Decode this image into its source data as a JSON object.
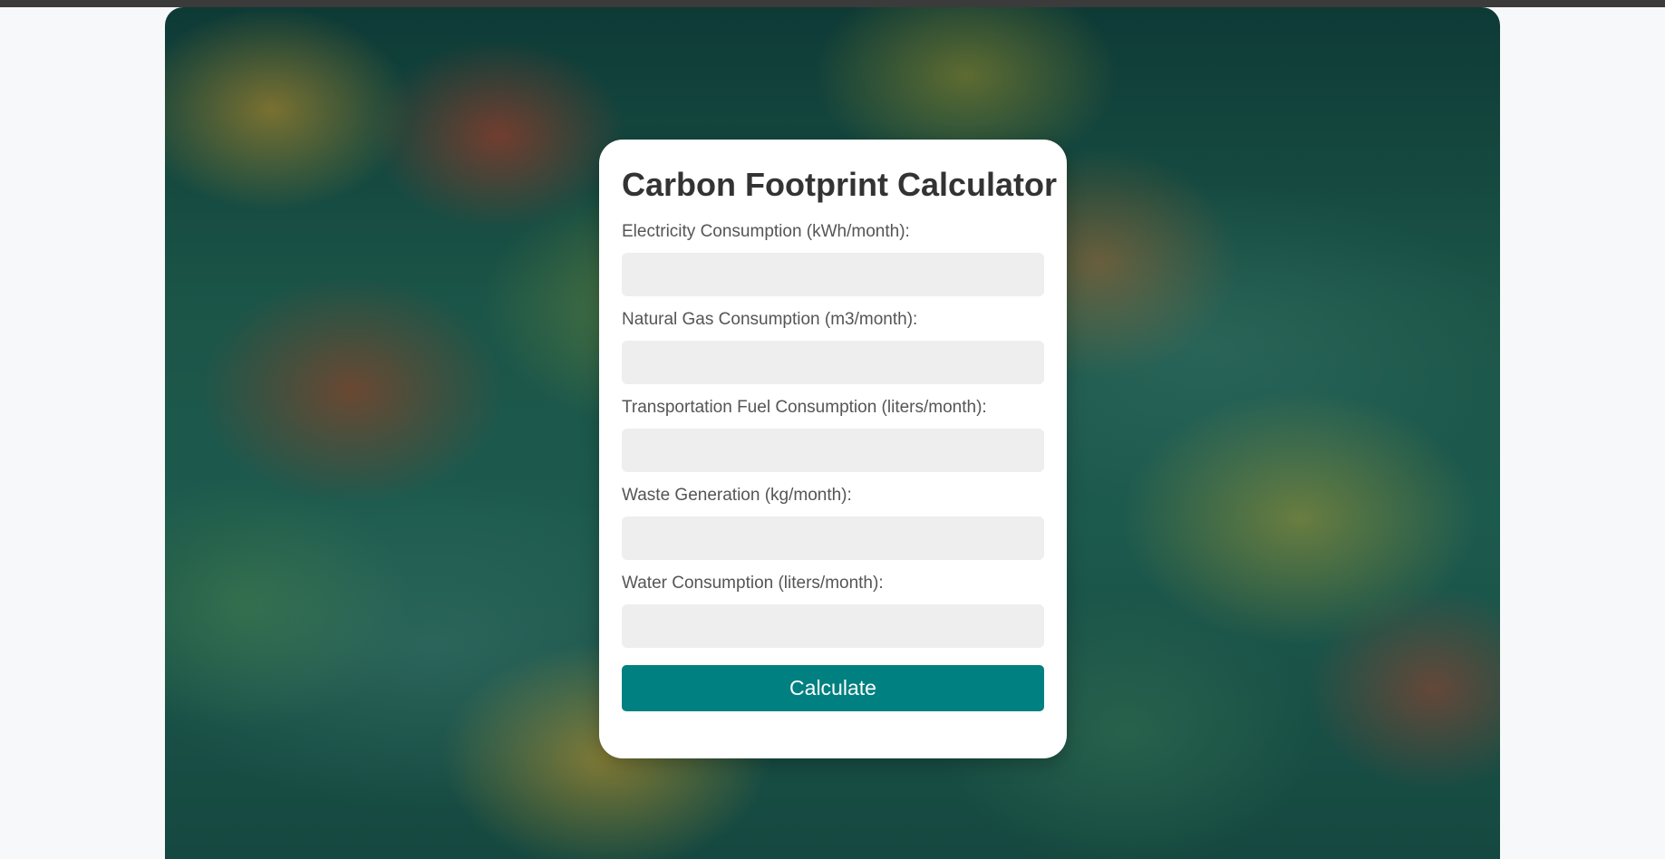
{
  "form": {
    "title": "Carbon Footprint Calculator",
    "fields": [
      {
        "label": "Electricity Consumption (kWh/month):",
        "value": "",
        "placeholder": ""
      },
      {
        "label": "Natural Gas Consumption (m3/month):",
        "value": "",
        "placeholder": ""
      },
      {
        "label": "Transportation Fuel Consumption (liters/month):",
        "value": "",
        "placeholder": ""
      },
      {
        "label": "Waste Generation (kg/month):",
        "value": "",
        "placeholder": ""
      },
      {
        "label": "Water Consumption (liters/month):",
        "value": "",
        "placeholder": ""
      }
    ],
    "submit_label": "Calculate"
  },
  "colors": {
    "accent": "#008080",
    "input_background": "#eeeeee",
    "card_background": "#ffffff",
    "title_text": "#333333",
    "label_text": "#555555",
    "page_background": "#f6f8fa"
  },
  "background_image": "misty-autumn-forest"
}
